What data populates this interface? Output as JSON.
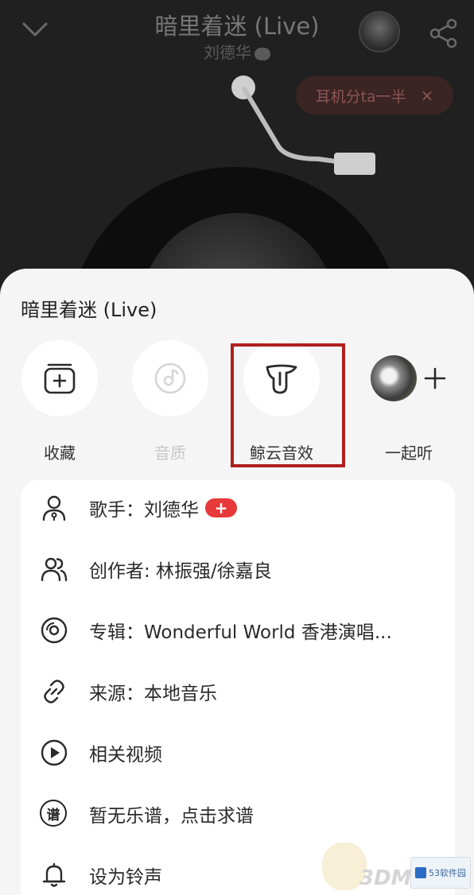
{
  "player": {
    "song_title": "暗里着迷 (Live)",
    "artist": "刘德华",
    "earphone_share": "耳机分ta一半",
    "close_symbol": "×"
  },
  "sheet": {
    "title": "暗里着迷 (Live)",
    "actions": [
      {
        "label": "收藏",
        "icon": "add-folder-icon"
      },
      {
        "label": "音质",
        "icon": "quality-icon",
        "disabled": true
      },
      {
        "label": "鲸云音效",
        "icon": "whale-cloud-icon",
        "highlighted": true
      },
      {
        "label": "一起听",
        "icon": "listen-together-icon"
      }
    ],
    "info": [
      {
        "text": "歌手：刘德华",
        "icon": "singer-icon",
        "badge": "+"
      },
      {
        "text": "创作者: 林振强/徐嘉良",
        "icon": "creators-icon"
      },
      {
        "text": "专辑：Wonderful World 香港演唱...",
        "icon": "album-icon"
      },
      {
        "text": "来源：本地音乐",
        "icon": "link-icon"
      },
      {
        "text": "相关视频",
        "icon": "video-icon"
      },
      {
        "text": "暂无乐谱，点击求谱",
        "icon": "score-icon",
        "icon_text": "谱"
      },
      {
        "text": "设为铃声",
        "icon": "bell-icon"
      }
    ]
  },
  "watermark": {
    "brand": "3DM",
    "site": "53软件园"
  },
  "colors": {
    "accent_red": "#e8393a",
    "highlight_box": "#b0201f",
    "sheet_bg": "#f5f5f5"
  }
}
